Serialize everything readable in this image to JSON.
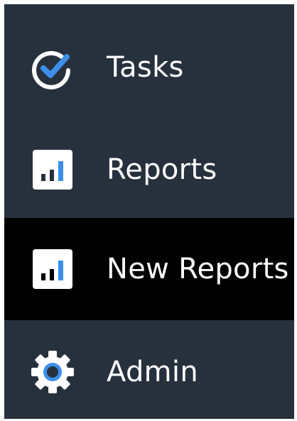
{
  "sidebar": {
    "items": [
      {
        "label": "Tasks",
        "icon": "check-circle-icon",
        "active": false
      },
      {
        "label": "Reports",
        "icon": "bar-chart-icon",
        "active": false
      },
      {
        "label": "New Reports",
        "icon": "bar-chart-icon",
        "active": true
      },
      {
        "label": "Admin",
        "icon": "gear-icon",
        "active": false
      }
    ]
  },
  "colors": {
    "background": "#27313d",
    "active_background": "#000000",
    "accent": "#3b8fe8",
    "text": "#ffffff"
  }
}
